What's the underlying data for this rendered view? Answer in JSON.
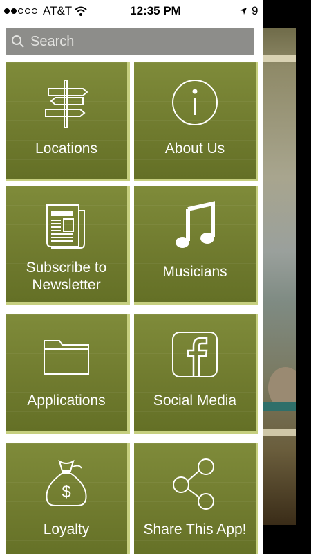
{
  "status_bar": {
    "carrier": "AT&T",
    "time": "12:35 PM",
    "battery": "9"
  },
  "search": {
    "placeholder": "Search"
  },
  "menu": {
    "items": [
      {
        "label": "Locations",
        "icon": "signpost-icon"
      },
      {
        "label": "About Us",
        "icon": "info-icon"
      },
      {
        "label": "Subscribe to Newsletter",
        "icon": "newspaper-icon"
      },
      {
        "label": "Musicians",
        "icon": "music-note-icon"
      },
      {
        "label": "Applications",
        "icon": "folder-icon"
      },
      {
        "label": "Social Media",
        "icon": "facebook-icon"
      },
      {
        "label": "Loyalty",
        "icon": "money-bag-icon"
      },
      {
        "label": "Share This App!",
        "icon": "share-icon"
      }
    ]
  },
  "colors": {
    "tile": "#6f7a2e",
    "tile_border": "#c6cf7f",
    "search_bg": "#8d8d8a"
  }
}
